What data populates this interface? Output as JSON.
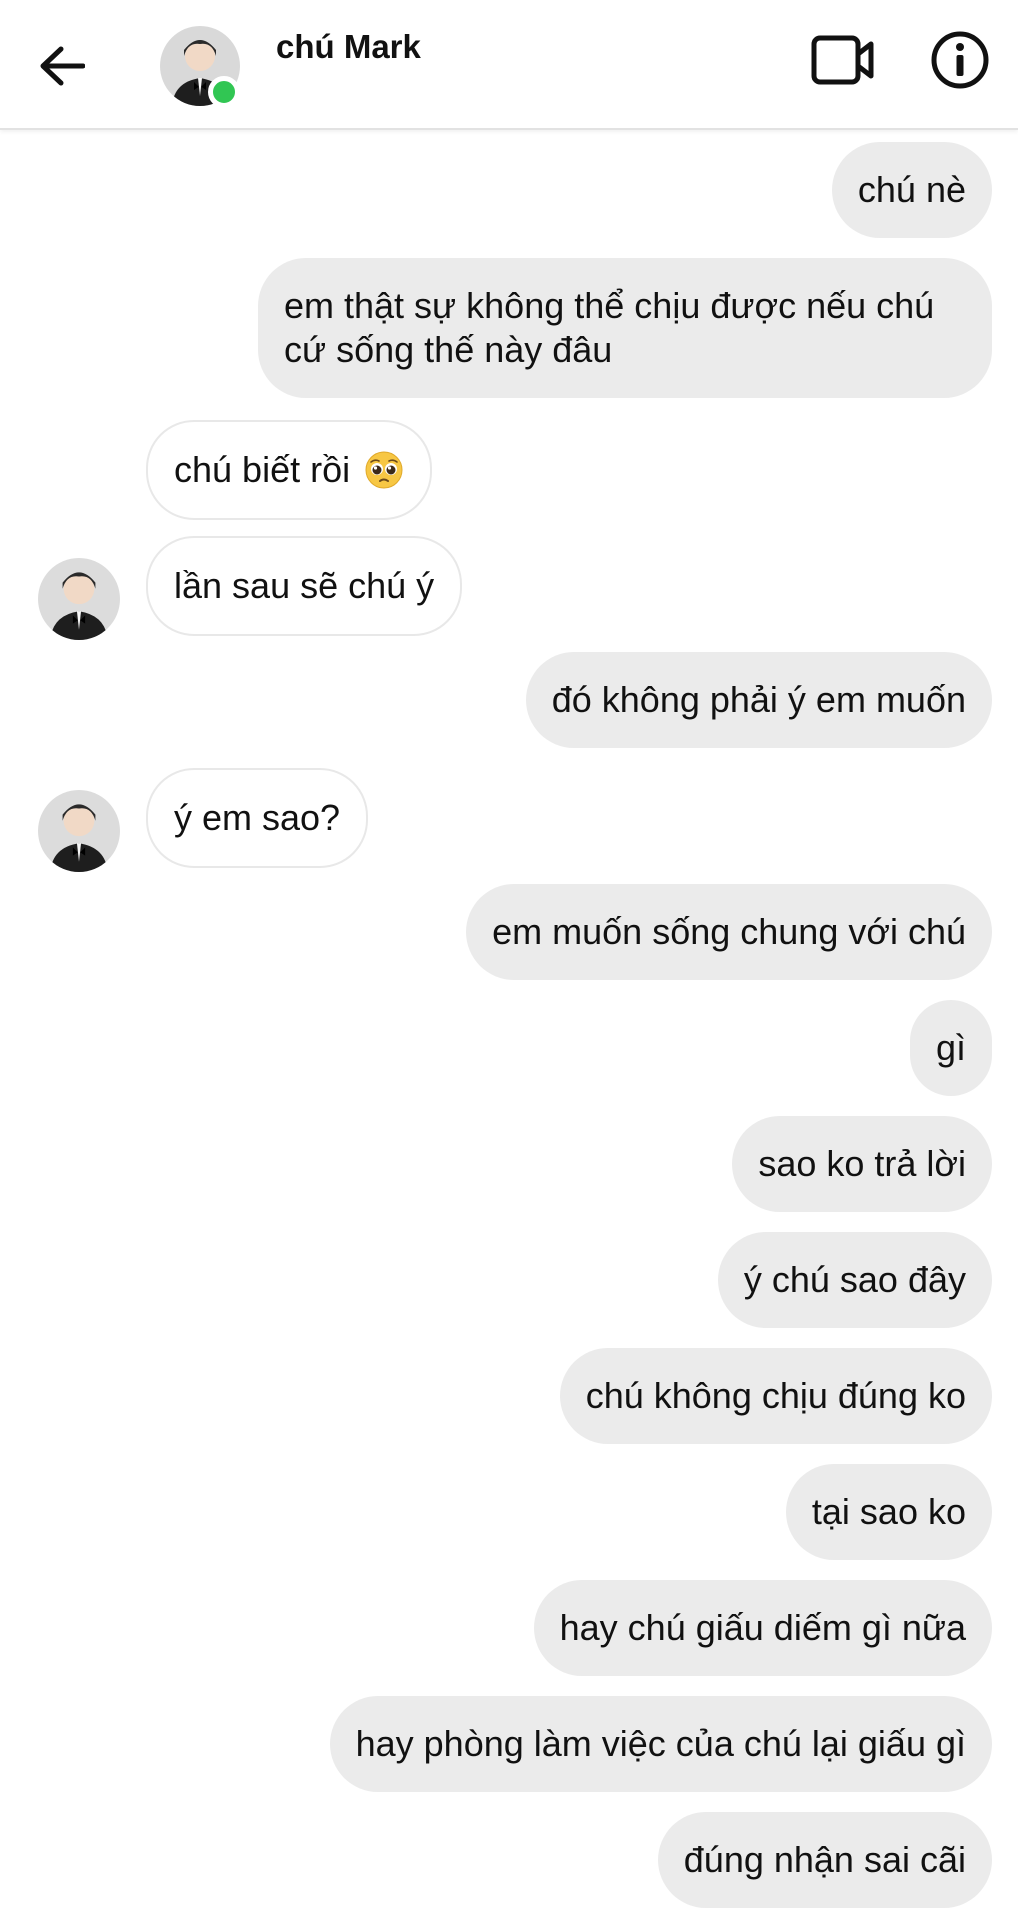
{
  "header": {
    "contact_name": "chú Mark",
    "online_color": "#31c653",
    "icons": {
      "back": "back-arrow-icon",
      "video": "video-call-icon",
      "info": "info-icon"
    }
  },
  "messages": [
    {
      "sender": "me",
      "text": "chú nè"
    },
    {
      "sender": "me",
      "text": "em thật sự không thể chịu được nếu chú cứ sống thế này đâu"
    },
    {
      "sender": "them",
      "text": "chú biết rồi",
      "emoji": "pleading-face-icon"
    },
    {
      "sender": "them",
      "text": "lần sau sẽ chú ý"
    },
    {
      "sender": "me",
      "text": "đó không phải ý em muốn"
    },
    {
      "sender": "them",
      "text": "ý em sao?"
    },
    {
      "sender": "me",
      "text": "em muốn sống chung với chú"
    },
    {
      "sender": "me",
      "text": "gì"
    },
    {
      "sender": "me",
      "text": "sao ko trả lời"
    },
    {
      "sender": "me",
      "text": "ý chú sao đây"
    },
    {
      "sender": "me",
      "text": "chú không chịu đúng ko"
    },
    {
      "sender": "me",
      "text": "tại sao ko"
    },
    {
      "sender": "me",
      "text": "hay chú giấu diếm gì nữa"
    },
    {
      "sender": "me",
      "text": "hay phòng làm việc của chú lại giấu gì"
    },
    {
      "sender": "me",
      "text": "đúng nhận sai cãi"
    }
  ],
  "colors": {
    "outgoing_bubble": "#ebebeb",
    "incoming_bubble": "#ffffff",
    "incoming_border": "#e8e8e8"
  }
}
